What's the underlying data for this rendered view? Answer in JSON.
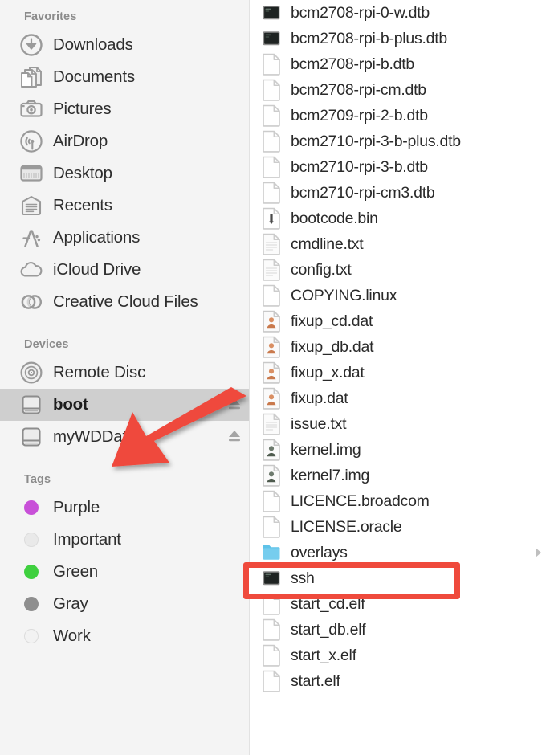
{
  "sidebar": {
    "sections": [
      {
        "name": "favorites",
        "header": "Favorites",
        "items": [
          {
            "label": "Downloads",
            "icon": "downloads-icon",
            "eject": false
          },
          {
            "label": "Documents",
            "icon": "documents-icon",
            "eject": false
          },
          {
            "label": "Pictures",
            "icon": "pictures-icon",
            "eject": false
          },
          {
            "label": "AirDrop",
            "icon": "airdrop-icon",
            "eject": false
          },
          {
            "label": "Desktop",
            "icon": "desktop-icon",
            "eject": false
          },
          {
            "label": "Recents",
            "icon": "recents-icon",
            "eject": false
          },
          {
            "label": "Applications",
            "icon": "applications-icon",
            "eject": false
          },
          {
            "label": "iCloud Drive",
            "icon": "icloud-drive-icon",
            "eject": false
          },
          {
            "label": "Creative Cloud Files",
            "icon": "creative-cloud-icon",
            "eject": false
          }
        ]
      },
      {
        "name": "devices",
        "header": "Devices",
        "items": [
          {
            "label": "Remote Disc",
            "icon": "remote-disc-icon",
            "eject": false,
            "selected": false
          },
          {
            "label": "boot",
            "icon": "hard-drive-icon",
            "eject": true,
            "selected": true
          },
          {
            "label": "myWDData",
            "icon": "hard-drive-icon",
            "eject": true,
            "selected": false
          }
        ]
      },
      {
        "name": "tags",
        "header": "Tags",
        "items": [
          {
            "label": "Purple",
            "icon": "tag-dot-icon",
            "color": "#c850d8"
          },
          {
            "label": "Important",
            "icon": "tag-dot-icon",
            "color": "#e9e9e9"
          },
          {
            "label": "Green",
            "icon": "tag-dot-icon",
            "color": "#3fd03f"
          },
          {
            "label": "Gray",
            "icon": "tag-dot-icon",
            "color": "#8e8e8e"
          },
          {
            "label": "Work",
            "icon": "tag-dot-icon",
            "color": "#f2f2f2"
          }
        ]
      }
    ]
  },
  "filelist": {
    "items": [
      {
        "name": "bcm2708-rpi-0-w.dtb",
        "icon": "unix-executable-icon"
      },
      {
        "name": "bcm2708-rpi-b-plus.dtb",
        "icon": "unix-executable-icon"
      },
      {
        "name": "bcm2708-rpi-b.dtb",
        "icon": "blank-document-icon"
      },
      {
        "name": "bcm2708-rpi-cm.dtb",
        "icon": "blank-document-icon"
      },
      {
        "name": "bcm2709-rpi-2-b.dtb",
        "icon": "blank-document-icon"
      },
      {
        "name": "bcm2710-rpi-3-b-plus.dtb",
        "icon": "blank-document-icon"
      },
      {
        "name": "bcm2710-rpi-3-b.dtb",
        "icon": "blank-document-icon"
      },
      {
        "name": "bcm2710-rpi-cm3.dtb",
        "icon": "blank-document-icon"
      },
      {
        "name": "bootcode.bin",
        "icon": "binary-document-icon"
      },
      {
        "name": "cmdline.txt",
        "icon": "text-document-icon"
      },
      {
        "name": "config.txt",
        "icon": "text-document-icon"
      },
      {
        "name": "COPYING.linux",
        "icon": "blank-document-icon"
      },
      {
        "name": "fixup_cd.dat",
        "icon": "data-document-icon"
      },
      {
        "name": "fixup_db.dat",
        "icon": "data-document-icon"
      },
      {
        "name": "fixup_x.dat",
        "icon": "data-document-icon"
      },
      {
        "name": "fixup.dat",
        "icon": "data-document-icon"
      },
      {
        "name": "issue.txt",
        "icon": "text-document-icon"
      },
      {
        "name": "kernel.img",
        "icon": "image-document-icon"
      },
      {
        "name": "kernel7.img",
        "icon": "image-document-icon"
      },
      {
        "name": "LICENCE.broadcom",
        "icon": "blank-document-icon"
      },
      {
        "name": "LICENSE.oracle",
        "icon": "blank-document-icon"
      },
      {
        "name": "overlays",
        "icon": "folder-icon",
        "disclosure": true
      },
      {
        "name": "ssh",
        "icon": "unix-executable-icon",
        "highlighted": true
      },
      {
        "name": "start_cd.elf",
        "icon": "blank-document-icon"
      },
      {
        "name": "start_db.elf",
        "icon": "blank-document-icon"
      },
      {
        "name": "start_x.elf",
        "icon": "blank-document-icon"
      },
      {
        "name": "start.elf",
        "icon": "blank-document-icon"
      }
    ]
  },
  "annotations": {
    "arrow": {
      "name": "red-pointer-arrow",
      "target": "boot",
      "color": "#ef4a3c"
    },
    "box": {
      "name": "red-highlight-box",
      "target": "ssh",
      "color": "#ef4a3c"
    }
  },
  "colors": {
    "sidebar_bg": "#f4f4f4",
    "list_bg": "#ffffff",
    "selection": "#cfcfcf",
    "annotation_red": "#ef4a3c",
    "folder_blue": "#6fc9ea"
  }
}
